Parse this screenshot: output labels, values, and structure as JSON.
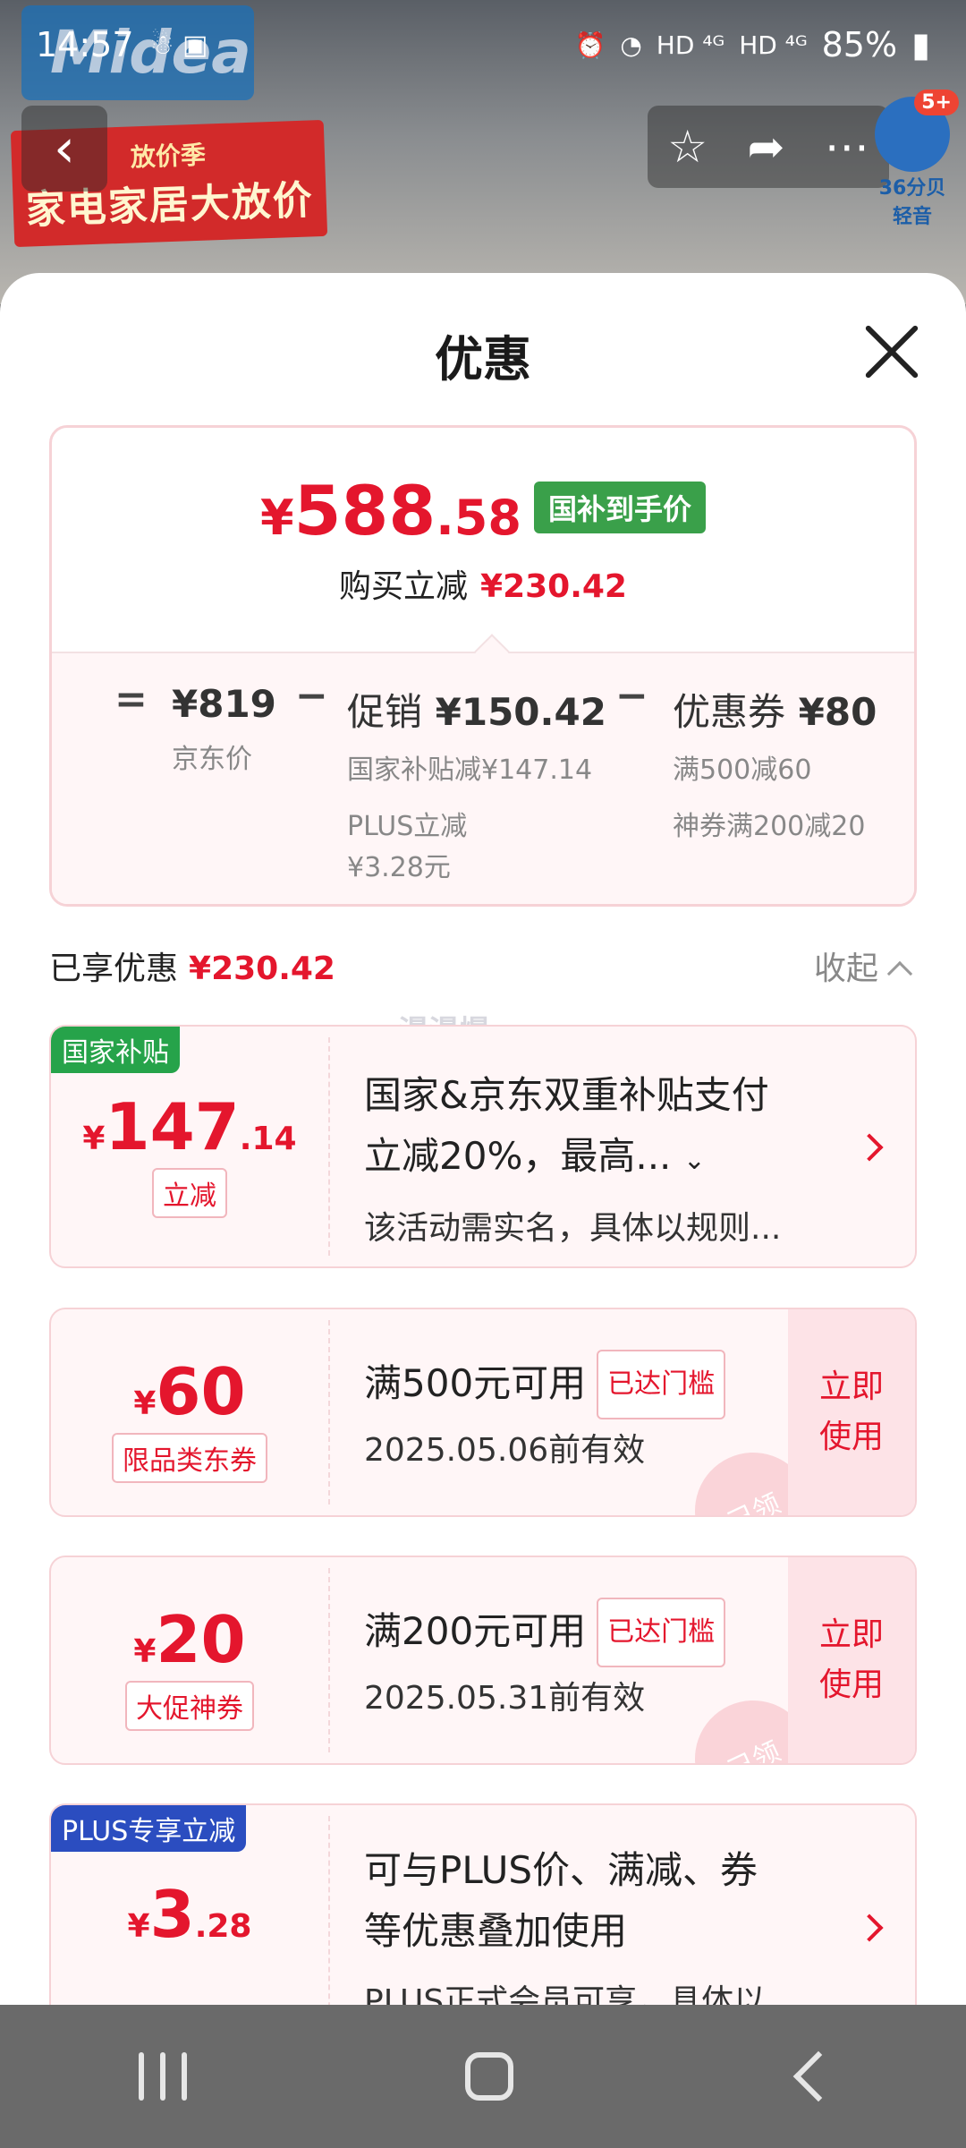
{
  "status_bar": {
    "time": "14:57",
    "network_1": "HD ⁴ᴳ",
    "network_2": "HD ⁴ᴳ",
    "battery": "85%"
  },
  "background": {
    "brand": "Midea",
    "promo_line1": "放价季",
    "promo_line2": "家电家居大放价",
    "audio_badge": "5+",
    "audio_label": "36分贝 轻音"
  },
  "sheet": {
    "title": "优惠"
  },
  "summary": {
    "final_price": {
      "symbol": "¥",
      "int": "588",
      "dec": ".58"
    },
    "final_tag": "国补到手价",
    "instant_label": "购买立减",
    "instant_amount": "¥230.42",
    "op_eq": "=",
    "op_minus1": "−",
    "op_minus2": "−",
    "jd_price": "¥819",
    "jd_label": "京东价",
    "promo_label": "促销",
    "promo_amount": "¥150.42",
    "promo_sub1": "国家补贴减¥147.14",
    "promo_sub2": "PLUS立减\n¥3.28元",
    "coupon_label": "优惠券",
    "coupon_amount": "¥80",
    "coupon_sub1": "满500减60",
    "coupon_sub2": "神券满200减20"
  },
  "enjoyed": {
    "label": "已享优惠",
    "amount": "¥230.42",
    "collapse": "收起"
  },
  "watermark": "漫漫爆",
  "cards": [
    {
      "tag": "国家补贴",
      "symbol": "¥",
      "int": "147",
      "dec": ".14",
      "sublabel": "立减",
      "title1": "国家&京东双重补贴支付",
      "title2": "立减20%，最高...",
      "desc": "该活动需实名，具体以规则..."
    },
    {
      "symbol": "¥",
      "int": "60",
      "sublabel": "限品类东券",
      "title": "满500元可用",
      "threshold": "已达门槛",
      "desc": "2025.05.06前有效",
      "use": "立即\n使用",
      "stamp": "已领"
    },
    {
      "symbol": "¥",
      "int": "20",
      "sublabel": "大促神券",
      "title": "满200元可用",
      "threshold": "已达门槛",
      "desc": "2025.05.31前有效",
      "use": "立即\n使用",
      "stamp": "已领"
    },
    {
      "tag": "PLUS专享立减",
      "symbol": "¥",
      "int": "3",
      "dec": ".28",
      "title1": "可与PLUS价、满减、券",
      "title2": "等优惠叠加使用",
      "desc": "PLUS正式会员可享，具体以..."
    }
  ],
  "colors": {
    "accent_red": "#e4162d",
    "tag_green": "#26a34a",
    "tag_blue": "#2b4dc0"
  }
}
